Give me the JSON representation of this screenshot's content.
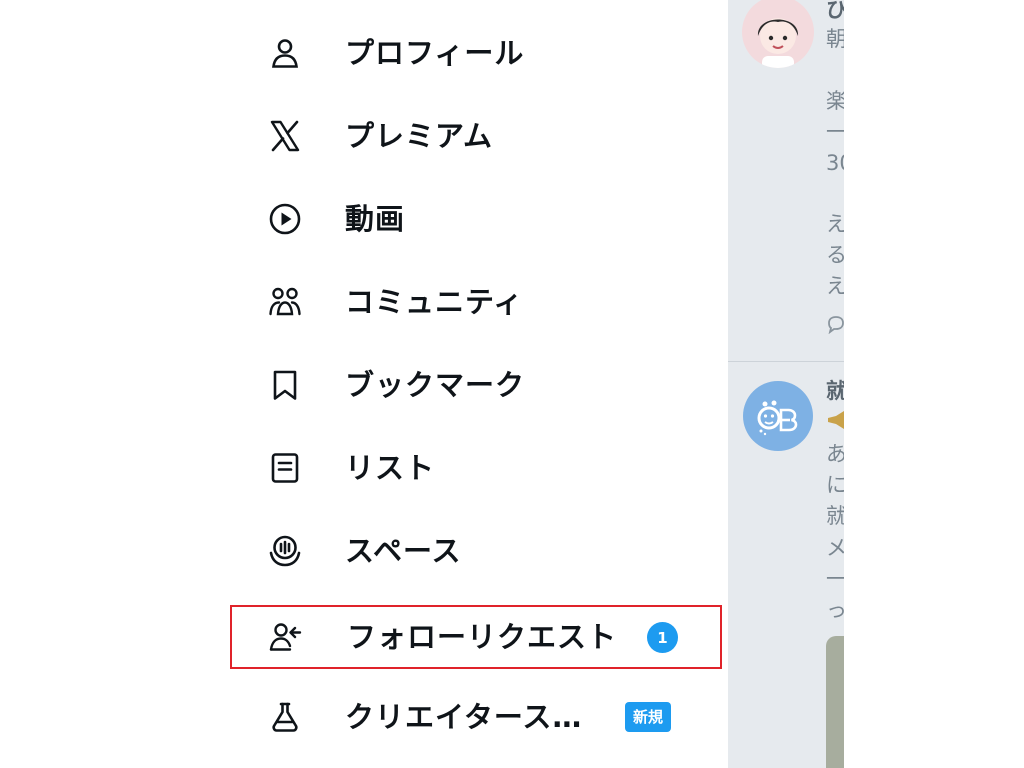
{
  "menu": {
    "items": [
      {
        "label": "プロフィール",
        "icon": "person-icon"
      },
      {
        "label": "プレミアム",
        "icon": "x-logo-icon"
      },
      {
        "label": "動画",
        "icon": "play-circle-icon"
      },
      {
        "label": "コミュニティ",
        "icon": "communities-icon"
      },
      {
        "label": "ブックマーク",
        "icon": "bookmark-icon"
      },
      {
        "label": "リスト",
        "icon": "list-icon"
      },
      {
        "label": "スペース",
        "icon": "spaces-icon"
      },
      {
        "label": "フォローリクエスト",
        "icon": "follow-request-icon",
        "badge": "1"
      },
      {
        "label": "クリエイタース…",
        "icon": "flask-icon",
        "badge": "新規"
      }
    ],
    "highlighted_item": "フォローリクエスト"
  },
  "timeline": {
    "post1": {
      "name_fragment": "ひ",
      "lines": [
        "朝",
        "楽",
        "一",
        "30",
        "え",
        "る",
        "え"
      ]
    },
    "post2": {
      "name_fragment": "就",
      "lines": [
        "あ",
        "に",
        "就",
        "メ",
        "一",
        "っ"
      ]
    }
  },
  "colors": {
    "accent": "#1d9bf0",
    "highlight_border": "#e0232a"
  }
}
